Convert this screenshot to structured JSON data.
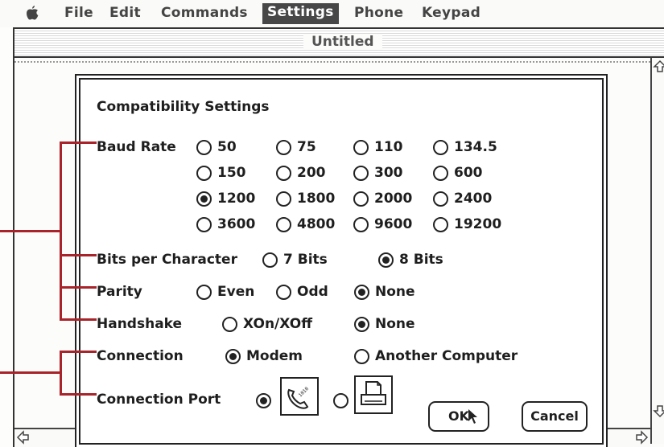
{
  "menubar": {
    "apple_icon": "apple-icon",
    "items": [
      "File",
      "Edit",
      "Commands",
      "Settings",
      "Phone",
      "Keypad"
    ],
    "selected": "Settings"
  },
  "window": {
    "title": "Untitled"
  },
  "dialog": {
    "title": "Compatibility Settings",
    "baud_rate": {
      "label": "Baud Rate",
      "options": [
        "50",
        "75",
        "110",
        "134.5",
        "150",
        "200",
        "300",
        "600",
        "1200",
        "1800",
        "2000",
        "2400",
        "3600",
        "4800",
        "9600",
        "19200"
      ],
      "selected": "1200"
    },
    "bits_per_character": {
      "label": "Bits per Character",
      "options": [
        "7 Bits",
        "8 Bits"
      ],
      "selected": "8 Bits"
    },
    "parity": {
      "label": "Parity",
      "options": [
        "Even",
        "Odd",
        "None"
      ],
      "selected": "None"
    },
    "handshake": {
      "label": "Handshake",
      "options": [
        "XOn/XOff",
        "None"
      ],
      "selected": "None"
    },
    "connection": {
      "label": "Connection",
      "options": [
        "Modem",
        "Another Computer"
      ],
      "selected": "Modem"
    },
    "connection_port": {
      "label": "Connection Port",
      "options": [
        "phone-port-icon",
        "printer-port-icon"
      ],
      "selected": "phone-port-icon"
    },
    "buttons": {
      "ok": "OK",
      "cancel": "Cancel"
    }
  },
  "colors": {
    "annotation_lines": "#a8242a",
    "menu_highlight": "#474747"
  }
}
